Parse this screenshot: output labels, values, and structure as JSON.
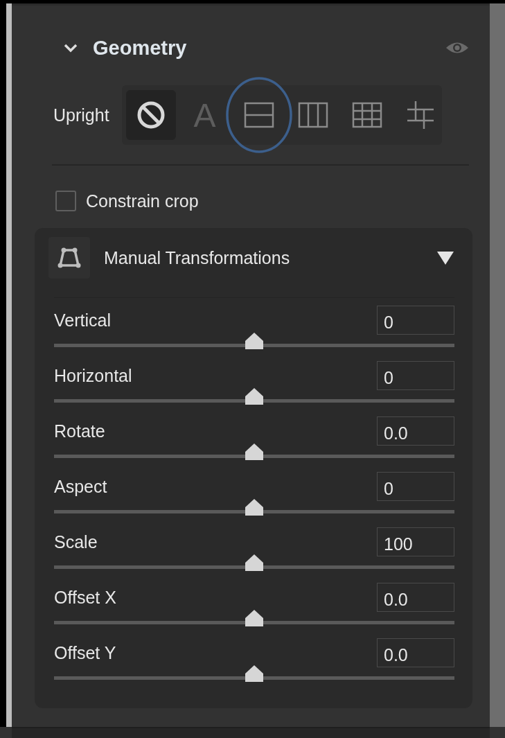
{
  "section": {
    "title": "Geometry",
    "expanded": true
  },
  "upright": {
    "label": "Upright",
    "options": [
      {
        "kind": "off",
        "selected": true,
        "circled": false
      },
      {
        "kind": "auto",
        "label": "A",
        "selected": false,
        "circled": false
      },
      {
        "kind": "level",
        "selected": false,
        "circled": true
      },
      {
        "kind": "vertical",
        "selected": false,
        "circled": false
      },
      {
        "kind": "full",
        "selected": false,
        "circled": false
      },
      {
        "kind": "guided",
        "selected": false,
        "circled": false
      }
    ]
  },
  "constrain_crop": {
    "label": "Constrain crop",
    "checked": false
  },
  "manual": {
    "title": "Manual Transformations",
    "expanded": true,
    "sliders": [
      {
        "name": "Vertical",
        "value": "0",
        "level": 0.5
      },
      {
        "name": "Horizontal",
        "value": "0",
        "level": 0.5
      },
      {
        "name": "Rotate",
        "value": "0.0",
        "level": 0.5
      },
      {
        "name": "Aspect",
        "value": "0",
        "level": 0.5
      },
      {
        "name": "Scale",
        "value": "100",
        "level": 0.5
      },
      {
        "name": "Offset X",
        "value": "0.0",
        "level": 0.5
      },
      {
        "name": "Offset Y",
        "value": "0.0",
        "level": 0.5
      }
    ]
  }
}
